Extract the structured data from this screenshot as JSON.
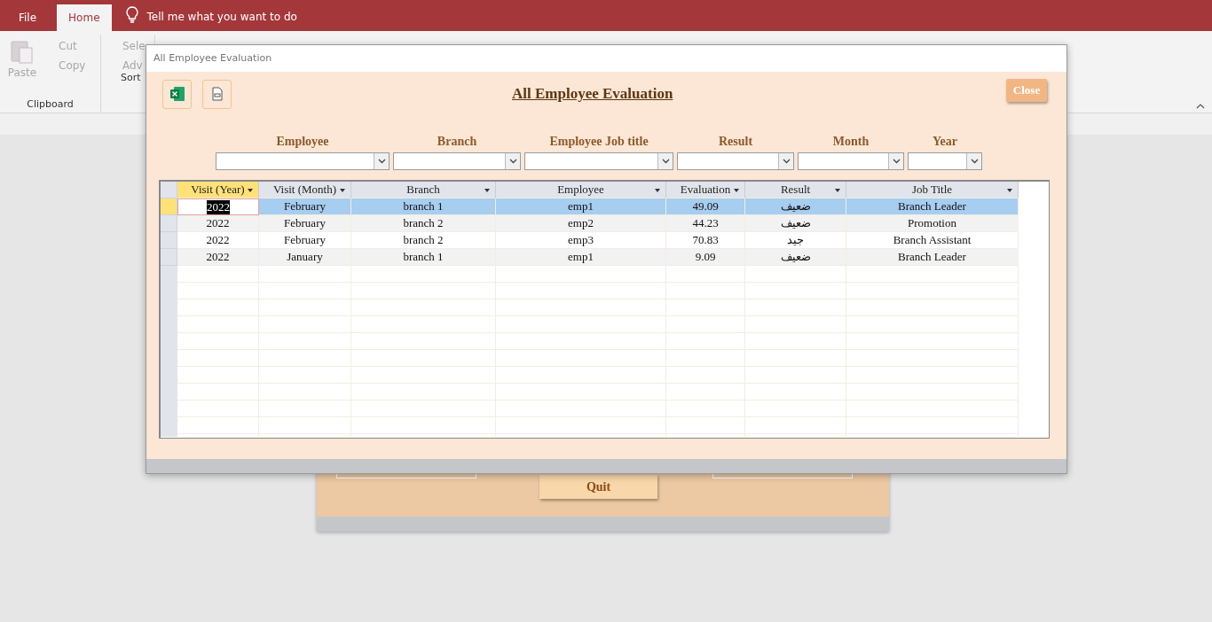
{
  "app": {
    "tabs": [
      {
        "label": "File",
        "selected": false
      },
      {
        "label": "Home",
        "selected": true
      }
    ],
    "tell_me": "Tell me what you want to do"
  },
  "ribbon": {
    "groups": [
      {
        "label": "Clipboard",
        "paste": "Paste",
        "commands": [
          "Cut",
          "Copy"
        ]
      },
      {
        "label": "Sort",
        "commands": [
          "Sele",
          "Adv"
        ]
      }
    ]
  },
  "background_form": {
    "button": "Quit"
  },
  "dialog": {
    "title": "All Employee Evaluation",
    "heading": "All Employee Evaluation",
    "close_button": "Close",
    "filters": [
      {
        "label": "Employee"
      },
      {
        "label": "Branch"
      },
      {
        "label": "Employee Job title"
      },
      {
        "label": "Result"
      },
      {
        "label": "Month"
      },
      {
        "label": "Year"
      }
    ],
    "table": {
      "columns": [
        {
          "label": "Visit (Year)",
          "selected": true
        },
        {
          "label": "Visit (Month)",
          "selected": false
        },
        {
          "label": "Branch",
          "selected": false
        },
        {
          "label": "Employee",
          "selected": false
        },
        {
          "label": "Evaluation",
          "selected": false
        },
        {
          "label": "Result",
          "selected": false
        },
        {
          "label": "Job Title",
          "selected": false
        }
      ],
      "rows": [
        {
          "selected": true,
          "cells": [
            "2022",
            "February",
            "branch 1",
            "emp1",
            "49.09",
            "ضعيف",
            "Branch Leader"
          ]
        },
        {
          "selected": false,
          "cells": [
            "2022",
            "February",
            "branch 2",
            "emp2",
            "44.23",
            "ضعيف",
            "Promotion"
          ]
        },
        {
          "selected": false,
          "cells": [
            "2022",
            "February",
            "branch 2",
            "emp3",
            "70.83",
            "جيد",
            "Branch Assistant"
          ]
        },
        {
          "selected": false,
          "cells": [
            "2022",
            "January",
            "branch 1",
            "emp1",
            "9.09",
            "ضعيف",
            "Branch Leader"
          ]
        }
      ]
    }
  }
}
